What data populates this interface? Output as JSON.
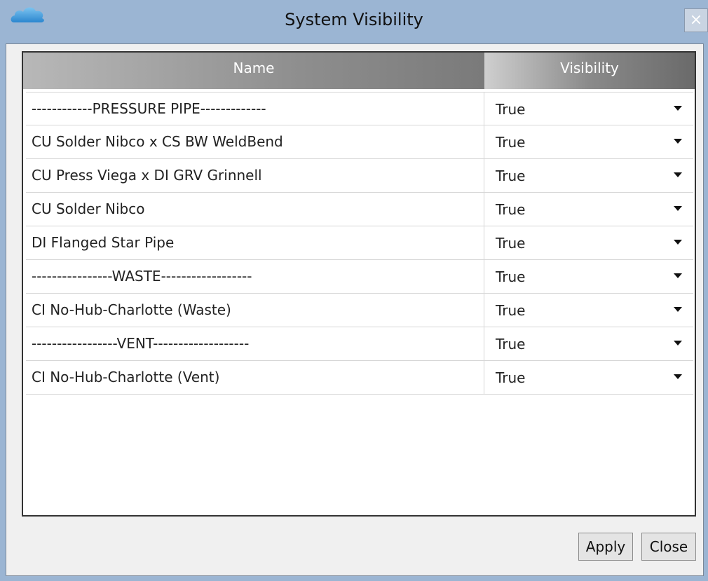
{
  "window": {
    "title": "System Visibility",
    "close_glyph": "×",
    "app_icon": "cloud-icon"
  },
  "table": {
    "columns": [
      "Name",
      "Visibility"
    ],
    "rows": [
      {
        "name": "------------PRESSURE PIPE-------------",
        "visibility": "True"
      },
      {
        "name": "CU Solder Nibco x CS BW WeldBend",
        "visibility": "True"
      },
      {
        "name": "CU Press Viega x DI GRV Grinnell",
        "visibility": "True"
      },
      {
        "name": "CU Solder Nibco",
        "visibility": "True"
      },
      {
        "name": "DI Flanged Star Pipe",
        "visibility": "True"
      },
      {
        "name": "----------------WASTE------------------",
        "visibility": "True"
      },
      {
        "name": "CI No-Hub-Charlotte (Waste)",
        "visibility": "True"
      },
      {
        "name": "-----------------VENT-------------------",
        "visibility": "True"
      },
      {
        "name": "CI No-Hub-Charlotte (Vent)",
        "visibility": "True"
      }
    ]
  },
  "buttons": {
    "apply": "Apply",
    "close": "Close"
  },
  "colors": {
    "titlebar": "#9bb5d3",
    "client_bg": "#f0f0f0",
    "header_gradient_dark": "#7a7a7a",
    "cloud_icon": "#3a9bdc"
  }
}
